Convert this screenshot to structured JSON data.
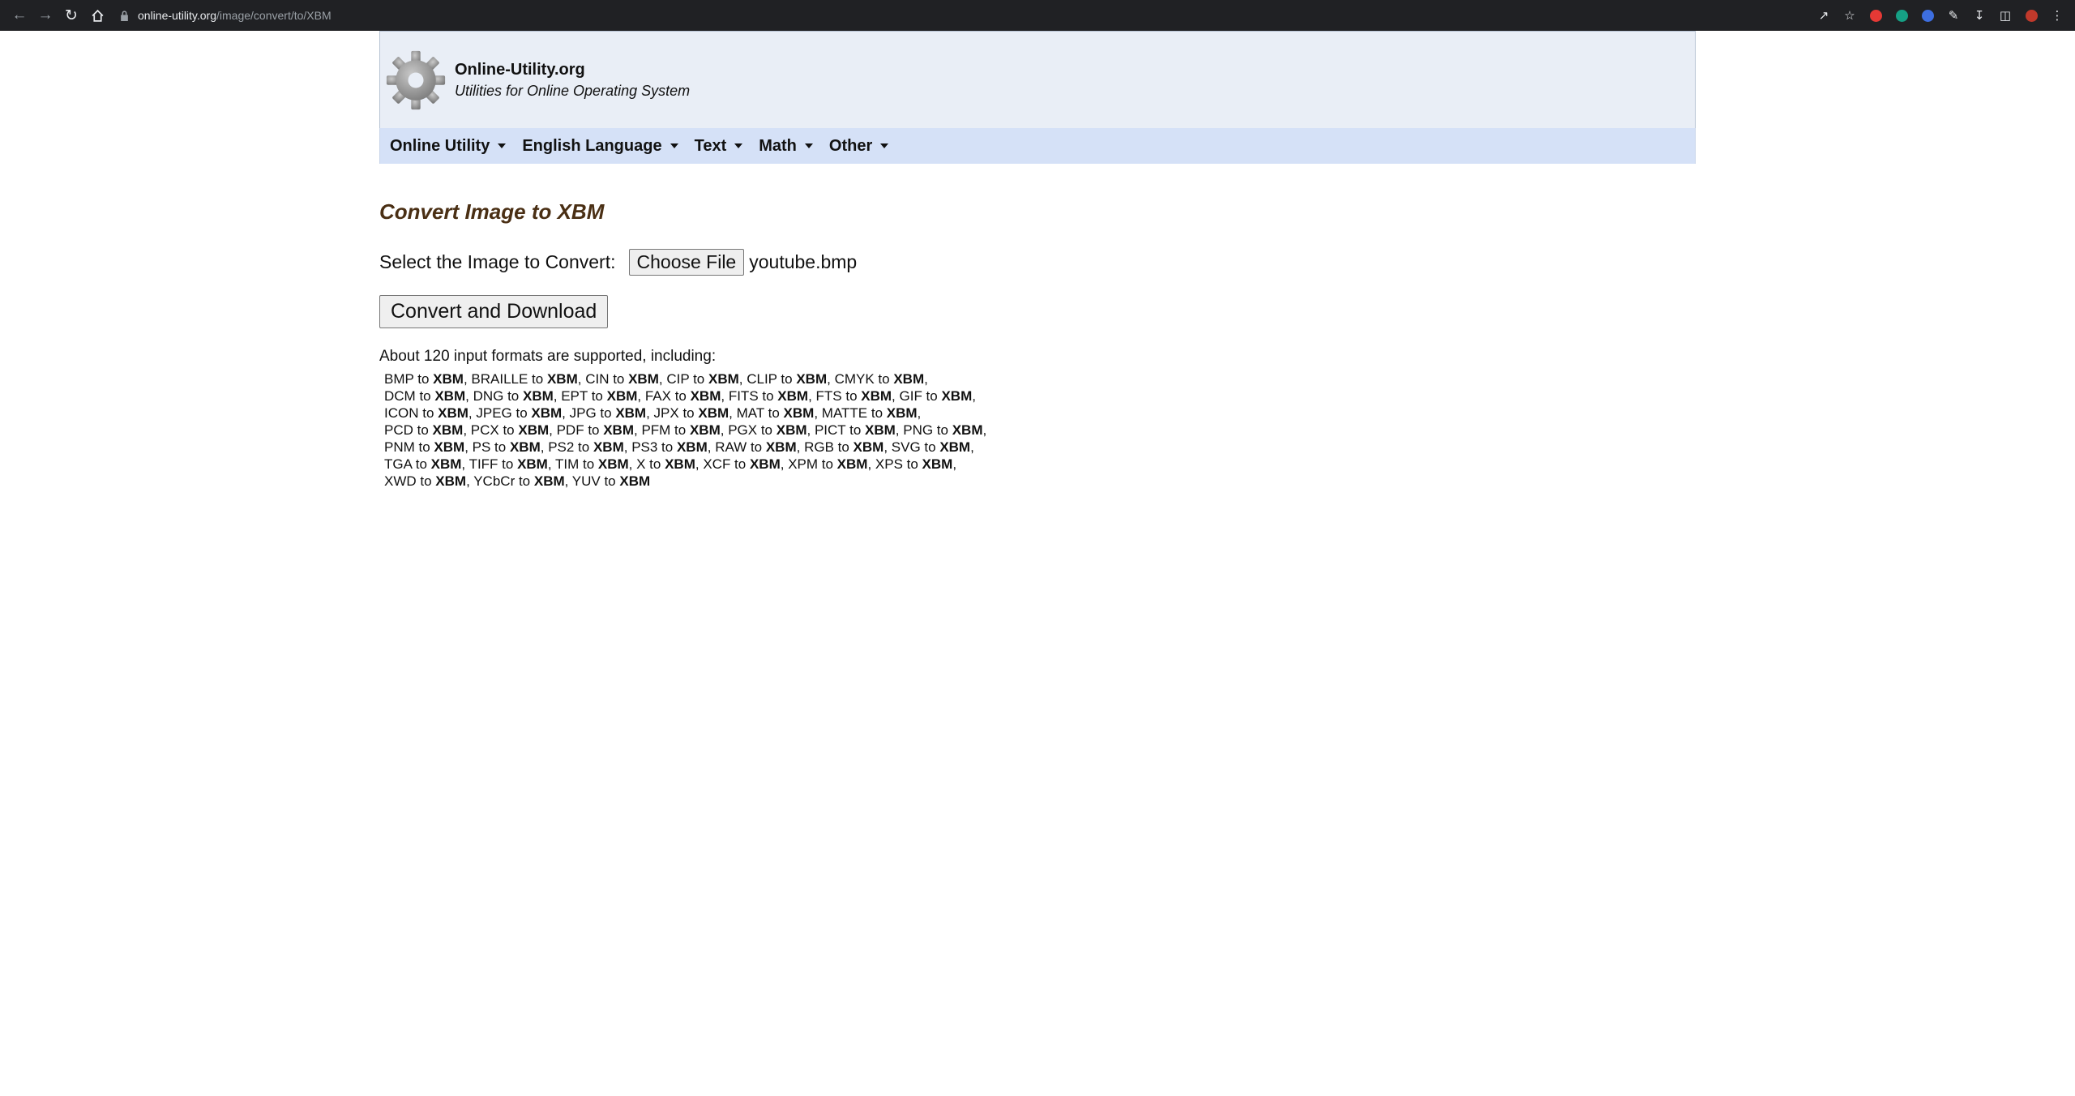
{
  "browser": {
    "url_host": "online-utility.org",
    "url_path": "/image/convert/to/XBM"
  },
  "header": {
    "site_name": "Online-Utility.org",
    "tagline": "Utilities for Online Operating System"
  },
  "menu": [
    {
      "label": "Online Utility"
    },
    {
      "label": "English Language"
    },
    {
      "label": "Text"
    },
    {
      "label": "Math"
    },
    {
      "label": "Other"
    }
  ],
  "main": {
    "title": "Convert Image to XBM",
    "file_label": "Select the Image to Convert:",
    "choose_file_label": "Choose File",
    "file_name": "youtube.bmp",
    "convert_label": "Convert and Download",
    "formats_intro": "About 120 input formats are supported, including:",
    "target": "XBM",
    "connector": "to",
    "format_lines": [
      [
        "BMP",
        "BRAILLE",
        "CIN",
        "CIP",
        "CLIP",
        "CMYK"
      ],
      [
        "DCM",
        "DNG",
        "EPT",
        "FAX",
        "FITS",
        "FTS",
        "GIF"
      ],
      [
        "ICON",
        "JPEG",
        "JPG",
        "JPX",
        "MAT",
        "MATTE"
      ],
      [
        "PCD",
        "PCX",
        "PDF",
        "PFM",
        "PGX",
        "PICT",
        "PNG"
      ],
      [
        "PNM",
        "PS",
        "PS2",
        "PS3",
        "RAW",
        "RGB",
        "SVG"
      ],
      [
        "TGA",
        "TIFF",
        "TIM",
        "X",
        "XCF",
        "XPM",
        "XPS"
      ],
      [
        "XWD",
        "YCbCr",
        "YUV"
      ]
    ]
  }
}
